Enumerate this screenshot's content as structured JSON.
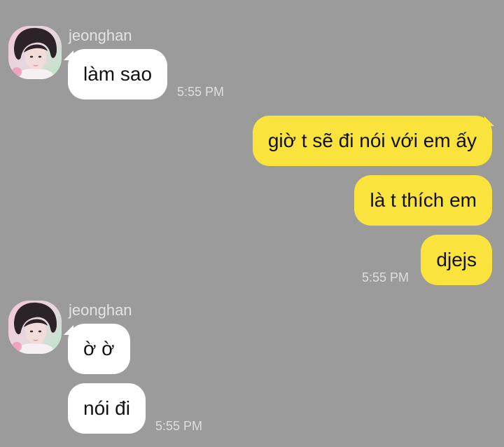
{
  "colors": {
    "background": "#9b9b9b",
    "incoming_bubble": "#ffffff",
    "outgoing_bubble": "#fbe33d",
    "secondary_text": "#e3e3e3"
  },
  "messages": [
    {
      "sender": "jeonghan",
      "avatar_icon": "profile-photo",
      "bubbles": [
        "làm sao"
      ],
      "time": "5:55 PM"
    },
    {
      "sender": "me",
      "bubbles": [
        "giờ t sẽ đi nói với em ấy",
        "là t thích em",
        "djejs"
      ],
      "time": "5:55 PM"
    },
    {
      "sender": "jeonghan",
      "avatar_icon": "profile-photo",
      "bubbles": [
        "ờ ờ",
        "nói đi"
      ],
      "time": "5:55 PM"
    }
  ]
}
